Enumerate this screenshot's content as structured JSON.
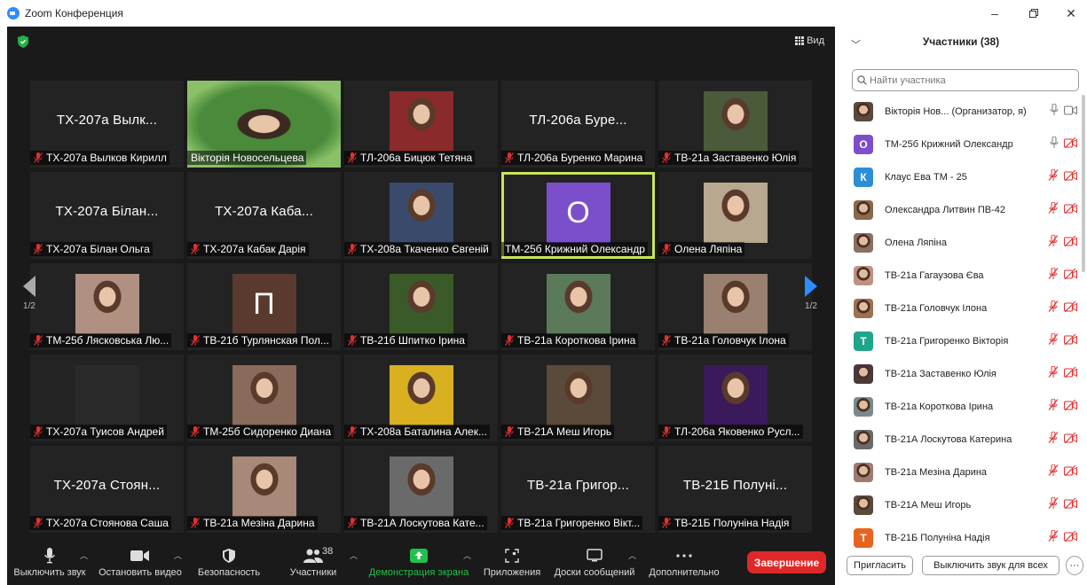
{
  "window": {
    "title": "Zoom Конференция"
  },
  "header": {
    "view_label": "Вид"
  },
  "tiles": [
    {
      "big": "ТХ-207а Вылк...",
      "name": "ТХ-207а Вылков Кирилл",
      "muted": true
    },
    {
      "big": "",
      "name": "Вікторія Новосельцева",
      "muted": false,
      "photo": "wide",
      "color": "#4a8a3a"
    },
    {
      "big": "",
      "name": "ТЛ-206а Бицюк Тетяна",
      "muted": true,
      "photo": "face",
      "color": "#8a2a2a"
    },
    {
      "big": "ТЛ-206а Буре...",
      "name": "ТЛ-206а Буренко Марина",
      "muted": true
    },
    {
      "big": "",
      "name": "ТВ-21а Заставенко Юлія",
      "muted": true,
      "photo": "face",
      "color": "#4a5a3a"
    },
    {
      "big": "ТХ-207а Білан...",
      "name": "ТХ-207а Білан Ольга",
      "muted": true
    },
    {
      "big": "ТХ-207а Каба...",
      "name": "ТХ-207а Кабак Дарія",
      "muted": true
    },
    {
      "big": "",
      "name": "ТХ-208а Ткаченко Євгеній",
      "muted": true,
      "photo": "face",
      "color": "#3a4a6a"
    },
    {
      "big": "",
      "name": "ТМ-25б Крижний Олександр",
      "muted": false,
      "letter": "O",
      "color": "#7b4fcc",
      "active": true
    },
    {
      "big": "",
      "name": "Олена Ляпіна",
      "muted": true,
      "photo": "face",
      "color": "#b8a890"
    },
    {
      "big": "",
      "name": "ТМ-25б Лясковська Лю...",
      "muted": true,
      "photo": "face",
      "color": "#b09080"
    },
    {
      "big": "",
      "name": "ТВ-21б Турлянская Пол...",
      "muted": true,
      "letter": "П",
      "color": "#5a3a2e"
    },
    {
      "big": "",
      "name": "ТВ-21б Шпитко Ірина",
      "muted": true,
      "photo": "face",
      "color": "#3a5a2a"
    },
    {
      "big": "",
      "name": "ТВ-21а Короткова Ірина",
      "muted": true,
      "photo": "face",
      "color": "#5a7a5a"
    },
    {
      "big": "",
      "name": "ТВ-21а Головчук Ілона",
      "muted": true,
      "photo": "face",
      "color": "#9a8070"
    },
    {
      "big": "",
      "name": "ТХ-207а Туисов Андрей",
      "muted": true,
      "photo": "dark",
      "color": "#2a2a2a"
    },
    {
      "big": "",
      "name": "ТМ-25б Сидоренко Диана",
      "muted": true,
      "photo": "face",
      "color": "#8a6a5a"
    },
    {
      "big": "",
      "name": "ТХ-208а Баталина Алек...",
      "muted": true,
      "photo": "face",
      "color": "#d8b020"
    },
    {
      "big": "",
      "name": "ТВ-21А Меш Игорь",
      "muted": true,
      "photo": "face",
      "color": "#5a4a3a"
    },
    {
      "big": "",
      "name": "ТЛ-206а Яковенко Русл...",
      "muted": true,
      "photo": "face",
      "color": "#3a1a5a"
    },
    {
      "big": "ТХ-207а Стоян...",
      "name": "ТХ-207а Стоянова Саша",
      "muted": true
    },
    {
      "big": "",
      "name": "ТВ-21а Мезіна Дарина",
      "muted": true,
      "photo": "face",
      "color": "#a88878"
    },
    {
      "big": "",
      "name": "ТВ-21А Лоскутова Кате...",
      "muted": true,
      "photo": "face",
      "color": "#6a6a6a"
    },
    {
      "big": "ТВ-21а Григор...",
      "name": "ТВ-21а Григоренко Вікт...",
      "muted": true
    },
    {
      "big": "ТВ-21Б Полуні...",
      "name": "ТВ-21Б Полуніна Надія",
      "muted": true
    }
  ],
  "pager": {
    "left_label": "1/2",
    "right_label": "1/2"
  },
  "toolbar": {
    "mute_label": "Выключить звук",
    "video_label": "Остановить видео",
    "security_label": "Безопасность",
    "participants_label": "Участники",
    "participants_count": "38",
    "share_label": "Демонстрация экрана",
    "apps_label": "Приложения",
    "whiteboard_label": "Доски сообщений",
    "more_label": "Дополнительно",
    "end_label": "Завершение"
  },
  "panel": {
    "title": "Участники (38)",
    "search_placeholder": "Найти участника",
    "participants": [
      {
        "name": "Вікторія Нов... (Организатор, я)",
        "avatar": "photo",
        "color": "#5a4a3a",
        "mic": "on",
        "cam": "on"
      },
      {
        "name": "ТМ-25б Крижний Олександр",
        "avatar": "letter",
        "letter": "O",
        "color": "#7b4fcc",
        "mic": "on",
        "cam": "off"
      },
      {
        "name": "Клаус Ева ТМ - 25",
        "avatar": "letter",
        "letter": "К",
        "color": "#2d8ed8",
        "mic": "off",
        "cam": "off"
      },
      {
        "name": "Олександра Литвин ПВ-42",
        "avatar": "photo",
        "color": "#8a6a4a",
        "mic": "off",
        "cam": "off"
      },
      {
        "name": "Олена Ляпіна",
        "avatar": "photo",
        "color": "#8a7060",
        "mic": "off",
        "cam": "off"
      },
      {
        "name": "ТВ-21а Гагаузова Єва",
        "avatar": "photo",
        "color": "#c09080",
        "mic": "off",
        "cam": "off"
      },
      {
        "name": "ТВ-21а Головчук Ілона",
        "avatar": "photo",
        "color": "#a07050",
        "mic": "off",
        "cam": "off"
      },
      {
        "name": "ТВ-21а Григоренко Вікторія",
        "avatar": "letter",
        "letter": "T",
        "color": "#1fa58a",
        "mic": "off",
        "cam": "off"
      },
      {
        "name": "ТВ-21а Заставенко Юлія",
        "avatar": "photo",
        "color": "#4a3a3a",
        "mic": "off",
        "cam": "off"
      },
      {
        "name": "ТВ-21а Короткова Ірина",
        "avatar": "photo",
        "color": "#7a8a8a",
        "mic": "off",
        "cam": "off"
      },
      {
        "name": "ТВ-21А Лоскутова Катерина",
        "avatar": "photo",
        "color": "#6a6a6a",
        "mic": "off",
        "cam": "off"
      },
      {
        "name": "ТВ-21а Мезіна Дарина",
        "avatar": "photo",
        "color": "#a07a70",
        "mic": "off",
        "cam": "off"
      },
      {
        "name": "ТВ-21А Меш Игорь",
        "avatar": "photo",
        "color": "#5a4a3a",
        "mic": "off",
        "cam": "off"
      },
      {
        "name": "ТВ-21Б Полуніна Надія",
        "avatar": "letter",
        "letter": "T",
        "color": "#e8641e",
        "mic": "off",
        "cam": "off"
      }
    ],
    "invite_label": "Пригласить",
    "mute_all_label": "Выключить звук для всех",
    "more_label": "···"
  },
  "colors": {
    "accent_blue": "#2d8cff",
    "end_red": "#e02828",
    "share_green": "#22c04a",
    "muted_red": "#e03030",
    "active_border": "#c8e55a"
  }
}
